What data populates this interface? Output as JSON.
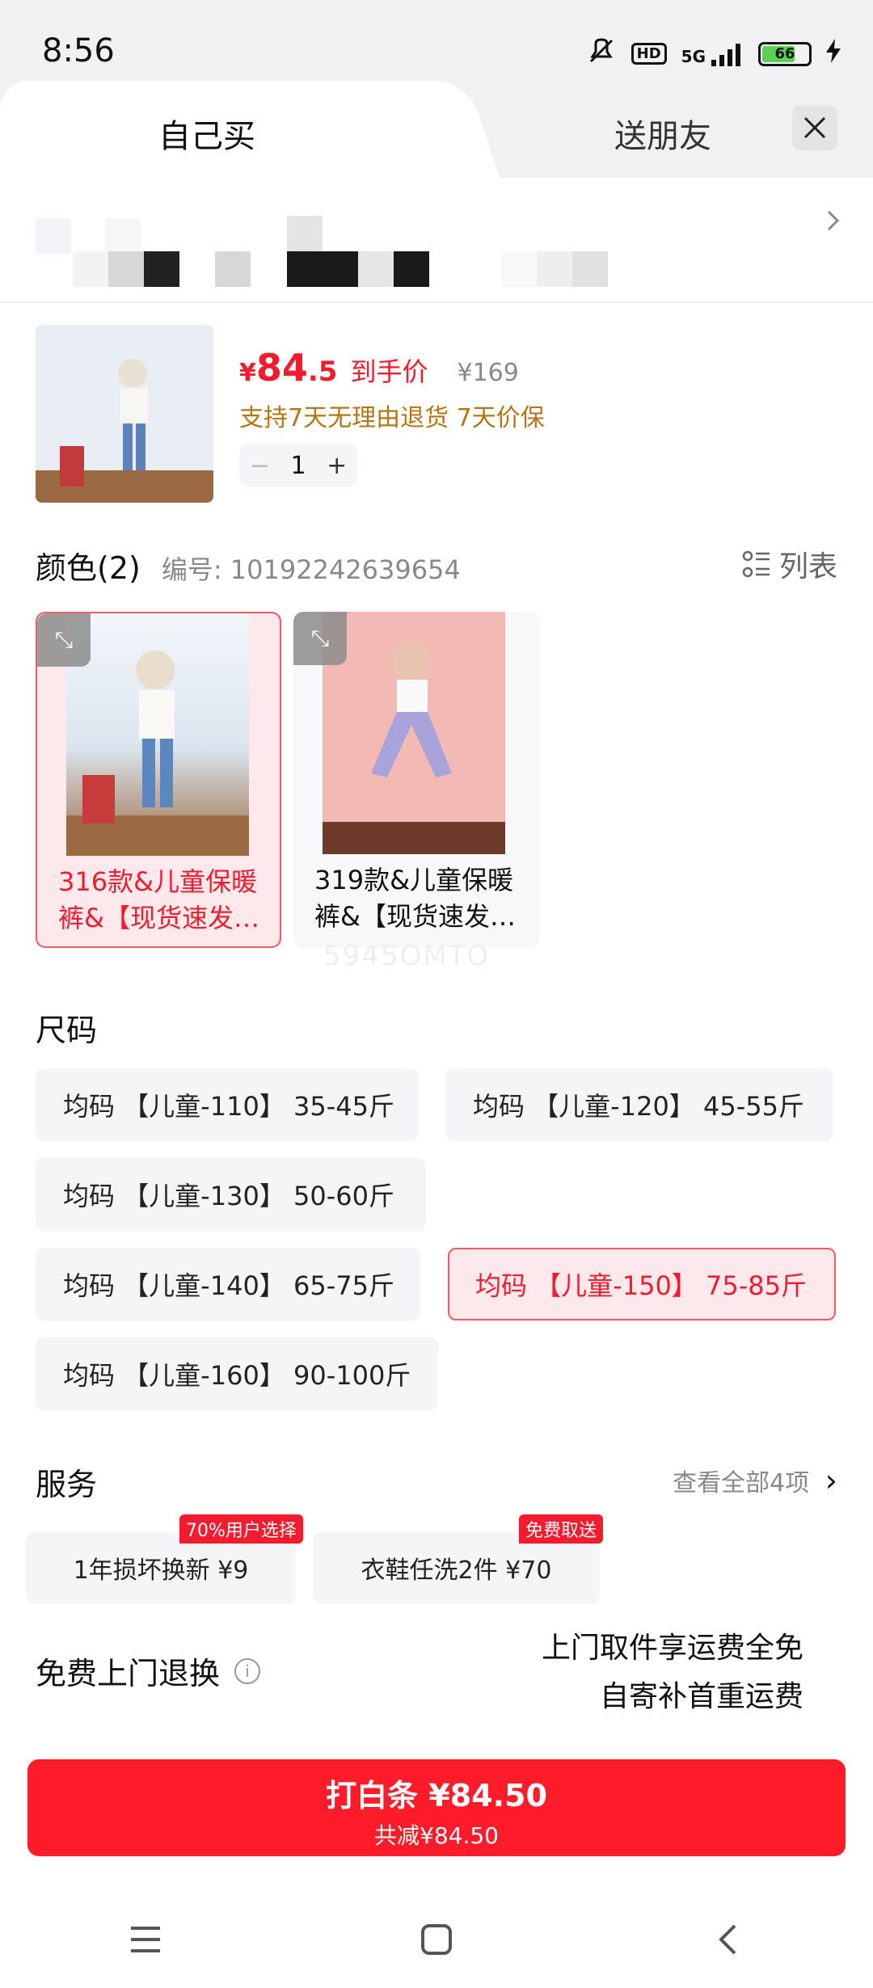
{
  "status_bar": {
    "time": "8:56",
    "network": "5G",
    "hd": "HD",
    "battery_level": "66",
    "battery_fraction": 0.66
  },
  "tabs": {
    "self_buy": "自己买",
    "gift_friend": "送朋友"
  },
  "product": {
    "price_yen": "¥",
    "price_int": "84",
    "price_dec": ".5",
    "price_tag": "到手价",
    "original_price": "¥169",
    "return_info": "支持7天无理由退货  7天价保",
    "quantity": "1",
    "minus": "−",
    "plus": "+"
  },
  "color_section": {
    "title": "颜色(2)",
    "code": "编号: 10192242639654",
    "list_label": "列表",
    "options": [
      {
        "label": "316款&儿童保暖裤&【现货速发…",
        "selected": true
      },
      {
        "label": "319款&儿童保暖裤&【现货速发…",
        "selected": false
      }
    ],
    "watermark": "5945OMTO"
  },
  "size_section": {
    "title": "尺码",
    "options": [
      {
        "label": "均码 【儿童-110】 35-45斤",
        "selected": false
      },
      {
        "label": "均码 【儿童-120】 45-55斤",
        "selected": false
      },
      {
        "label": "均码 【儿童-130】 50-60斤",
        "selected": false
      },
      {
        "label": "均码 【儿童-140】 65-75斤",
        "selected": false
      },
      {
        "label": "均码 【儿童-150】 75-85斤",
        "selected": true
      },
      {
        "label": "均码 【儿童-160】 90-100斤",
        "selected": false
      }
    ]
  },
  "service_section": {
    "title": "服务",
    "more": "查看全部4项",
    "chevron": "›",
    "options": [
      {
        "label": "1年损坏换新  ¥9",
        "badge": "70%用户选择"
      },
      {
        "label": "衣鞋任洗2件  ¥70",
        "badge": "免费取送"
      }
    ]
  },
  "free_return": {
    "title": "免费上门退换",
    "info": "i",
    "line1": "上门取件享运费全免",
    "line2": "自寄补首重运费"
  },
  "pay_button": {
    "main": "打白条 ¥84.50",
    "sub": "共减¥84.50"
  },
  "colors": {
    "accent": "#f21c2e",
    "button": "#ff1c2a",
    "selected_bg": "#fde9ec",
    "return_info": "#b47610"
  }
}
